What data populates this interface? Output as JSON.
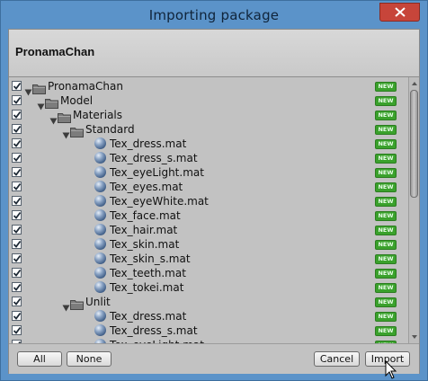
{
  "window": {
    "title": "Importing package"
  },
  "header": {
    "package_name": "PronamaChan"
  },
  "tree": {
    "new_badge": "NEW",
    "items": [
      {
        "label": "PronamaChan",
        "kind": "folder",
        "depth": 0,
        "checked": true,
        "new": true
      },
      {
        "label": "Model",
        "kind": "folder",
        "depth": 1,
        "checked": true,
        "new": true
      },
      {
        "label": "Materials",
        "kind": "folder",
        "depth": 2,
        "checked": true,
        "new": true
      },
      {
        "label": "Standard",
        "kind": "folder",
        "depth": 3,
        "checked": true,
        "new": true
      },
      {
        "label": "Tex_dress.mat",
        "kind": "material",
        "depth": 4,
        "checked": true,
        "new": true
      },
      {
        "label": "Tex_dress_s.mat",
        "kind": "material",
        "depth": 4,
        "checked": true,
        "new": true
      },
      {
        "label": "Tex_eyeLight.mat",
        "kind": "material",
        "depth": 4,
        "checked": true,
        "new": true
      },
      {
        "label": "Tex_eyes.mat",
        "kind": "material",
        "depth": 4,
        "checked": true,
        "new": true
      },
      {
        "label": "Tex_eyeWhite.mat",
        "kind": "material",
        "depth": 4,
        "checked": true,
        "new": true
      },
      {
        "label": "Tex_face.mat",
        "kind": "material",
        "depth": 4,
        "checked": true,
        "new": true
      },
      {
        "label": "Tex_hair.mat",
        "kind": "material",
        "depth": 4,
        "checked": true,
        "new": true
      },
      {
        "label": "Tex_skin.mat",
        "kind": "material",
        "depth": 4,
        "checked": true,
        "new": true
      },
      {
        "label": "Tex_skin_s.mat",
        "kind": "material",
        "depth": 4,
        "checked": true,
        "new": true
      },
      {
        "label": "Tex_teeth.mat",
        "kind": "material",
        "depth": 4,
        "checked": true,
        "new": true
      },
      {
        "label": "Tex_tokei.mat",
        "kind": "material",
        "depth": 4,
        "checked": true,
        "new": true
      },
      {
        "label": "Unlit",
        "kind": "folder",
        "depth": 3,
        "checked": true,
        "new": true
      },
      {
        "label": "Tex_dress.mat",
        "kind": "material",
        "depth": 4,
        "checked": true,
        "new": true
      },
      {
        "label": "Tex_dress_s.mat",
        "kind": "material",
        "depth": 4,
        "checked": true,
        "new": true
      },
      {
        "label": "Tex_eyeLight.mat",
        "kind": "material",
        "depth": 4,
        "checked": true,
        "new": true
      }
    ]
  },
  "footer": {
    "all_label": "All",
    "none_label": "None",
    "cancel_label": "Cancel",
    "import_label": "Import"
  },
  "colors": {
    "window_frame": "#5b93c9",
    "close_button": "#c7453a",
    "panel_bg": "#c2c2c2",
    "new_badge": "#3aa12c"
  }
}
